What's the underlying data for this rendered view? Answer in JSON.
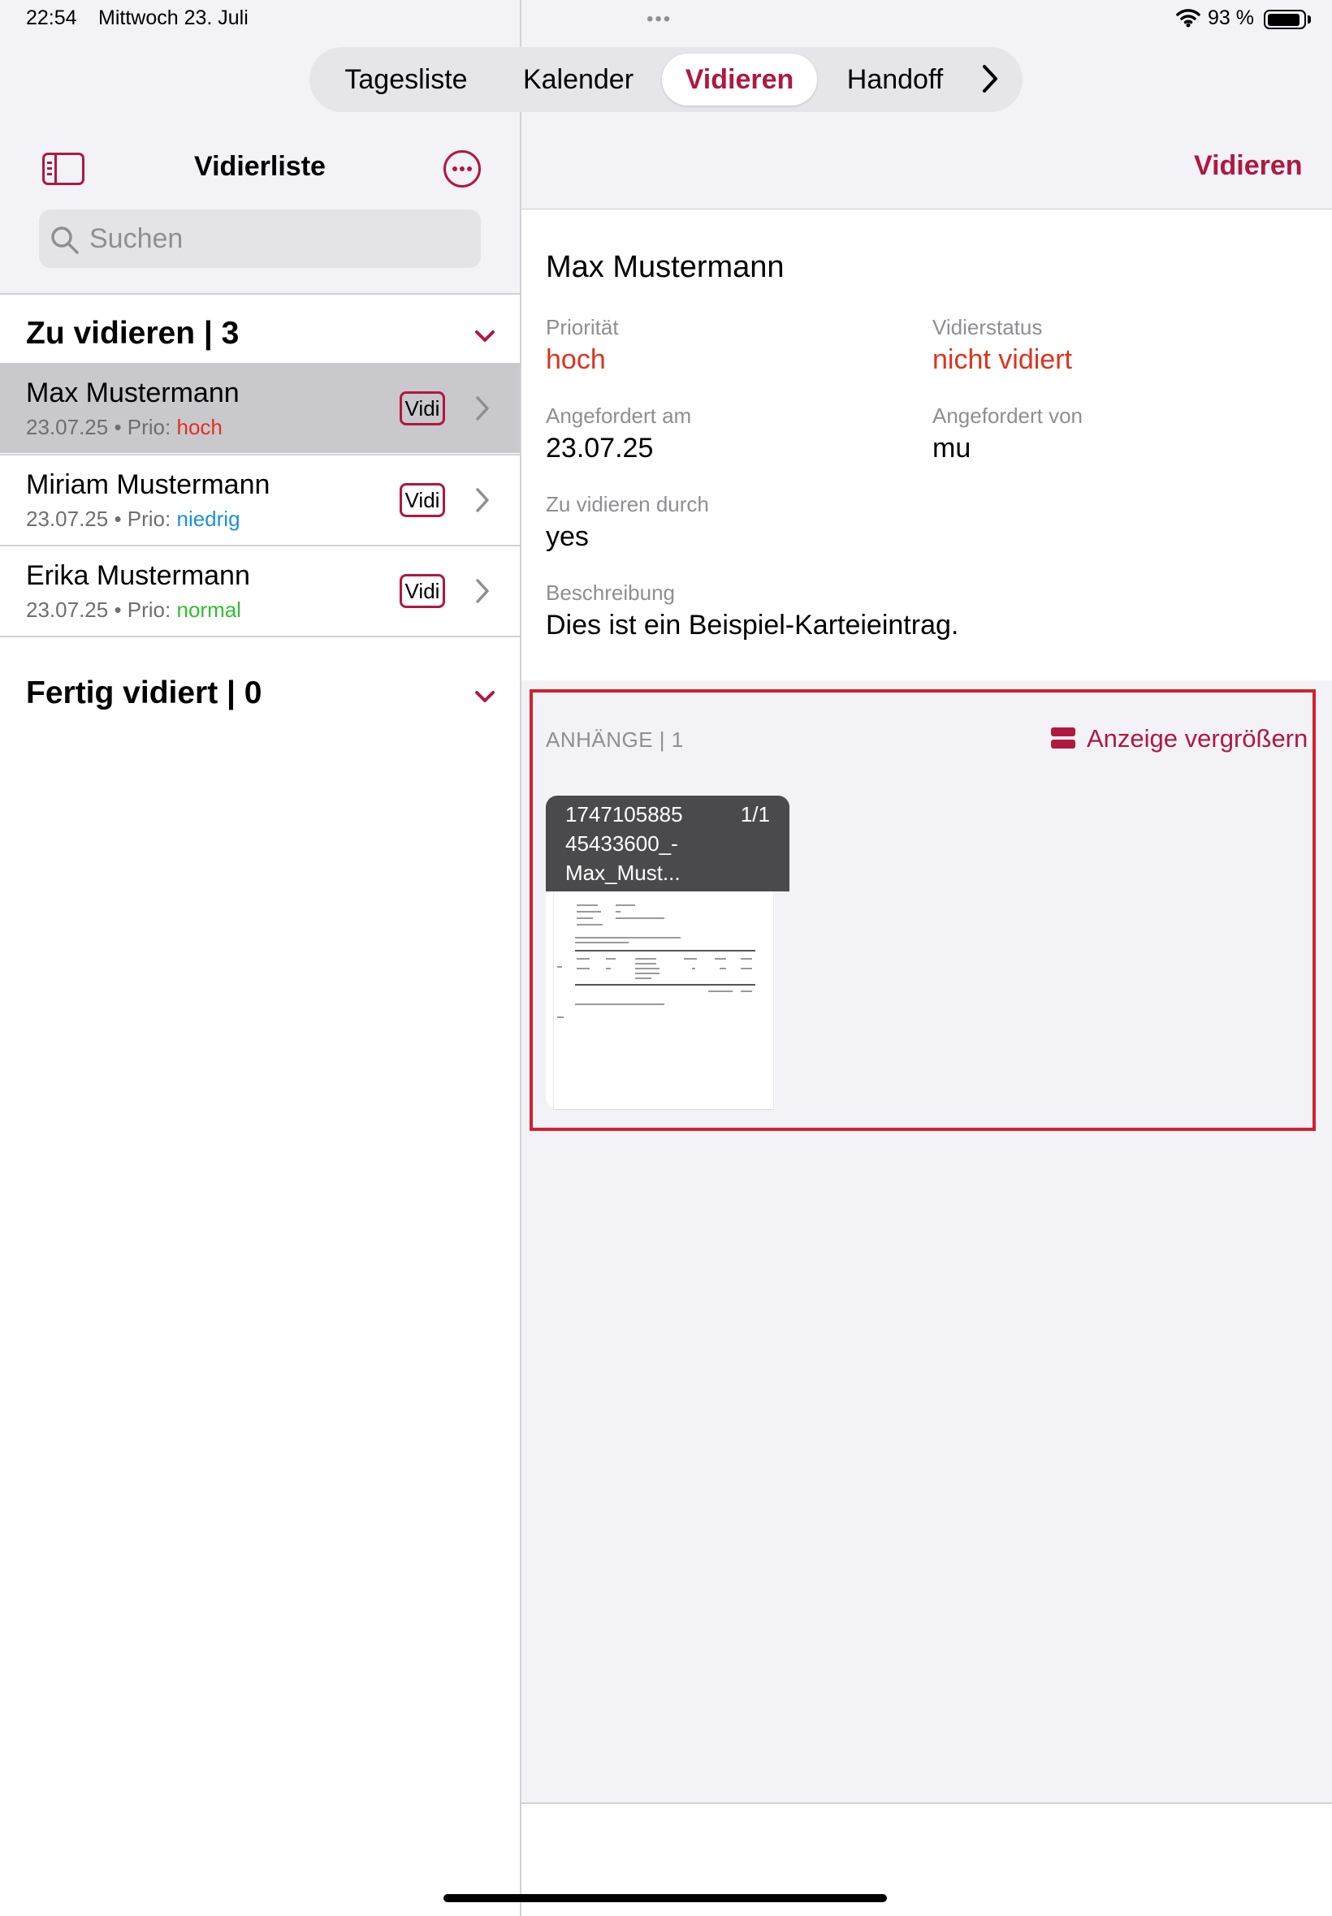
{
  "status_bar": {
    "time": "22:54",
    "date": "Mittwoch 23. Juli",
    "battery": "93 %",
    "battery_level": 0.93
  },
  "segmented_control": {
    "items": [
      "Tagesliste",
      "Kalender",
      "Vidieren",
      "Handoff"
    ],
    "selected": "Vidieren"
  },
  "sidebar": {
    "title": "Vidierliste",
    "search_placeholder": "Suchen",
    "sections": [
      {
        "title": "Zu vidieren | 3",
        "items": [
          {
            "name": "Max Mustermann",
            "date": "23.07.25",
            "prio_label": "Prio:",
            "prio": "hoch",
            "prio_color": "#e0321d",
            "badge": "Vidi",
            "selected": true
          },
          {
            "name": "Miriam Mustermann",
            "date": "23.07.25",
            "prio_label": "Prio:",
            "prio": "niedrig",
            "prio_color": "#1b8fe0",
            "badge": "Vidi",
            "selected": false
          },
          {
            "name": "Erika Mustermann",
            "date": "23.07.25",
            "prio_label": "Prio:",
            "prio": "normal",
            "prio_color": "#2fbf2f",
            "badge": "Vidi",
            "selected": false
          }
        ]
      },
      {
        "title": "Fertig vidiert | 0",
        "items": []
      }
    ]
  },
  "detail": {
    "action": "Vidieren",
    "name": "Max Mustermann",
    "fields": {
      "prioritaet_label": "Priorität",
      "prioritaet_value": "hoch",
      "vidierstatus_label": "Vidierstatus",
      "vidierstatus_value": "nicht vidiert",
      "angefordert_am_label": "Angefordert am",
      "angefordert_am_value": "23.07.25",
      "angefordert_von_label": "Angefordert von",
      "angefordert_von_value": "mu",
      "zu_vidieren_durch_label": "Zu vidieren durch",
      "zu_vidieren_durch_value": "yes",
      "beschreibung_label": "Beschreibung",
      "beschreibung_value": "Dies ist ein Beispiel-Karteieintrag."
    },
    "attachments": {
      "heading": "ANHÄNGE | 1",
      "enlarge_label": "Anzeige vergrößern",
      "file_lines": [
        "1747105885",
        "45433600_-",
        "Max_Must..."
      ],
      "page_indicator": "1/1"
    }
  },
  "colors": {
    "accent": "#b0183f",
    "highlight_frame": "#d2202f",
    "status_red": "#e0321d"
  }
}
